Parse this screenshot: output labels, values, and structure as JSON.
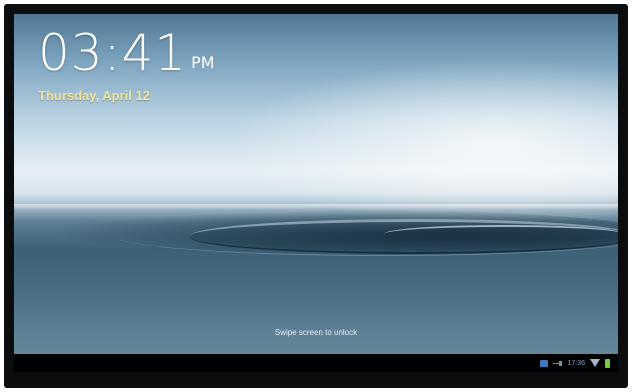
{
  "lockscreen": {
    "time": "03:41",
    "ampm": "PM",
    "date": "Thursday, April 12",
    "unlock_hint": "Swipe screen to unlock"
  },
  "status_bar": {
    "time": "17:36",
    "icons": [
      "mail-icon",
      "usb-icon",
      "wifi-icon",
      "battery-icon"
    ]
  },
  "colors": {
    "date_text": "#f3e39a",
    "status_bar_bg": "#000000",
    "battery": "#7ac943"
  }
}
